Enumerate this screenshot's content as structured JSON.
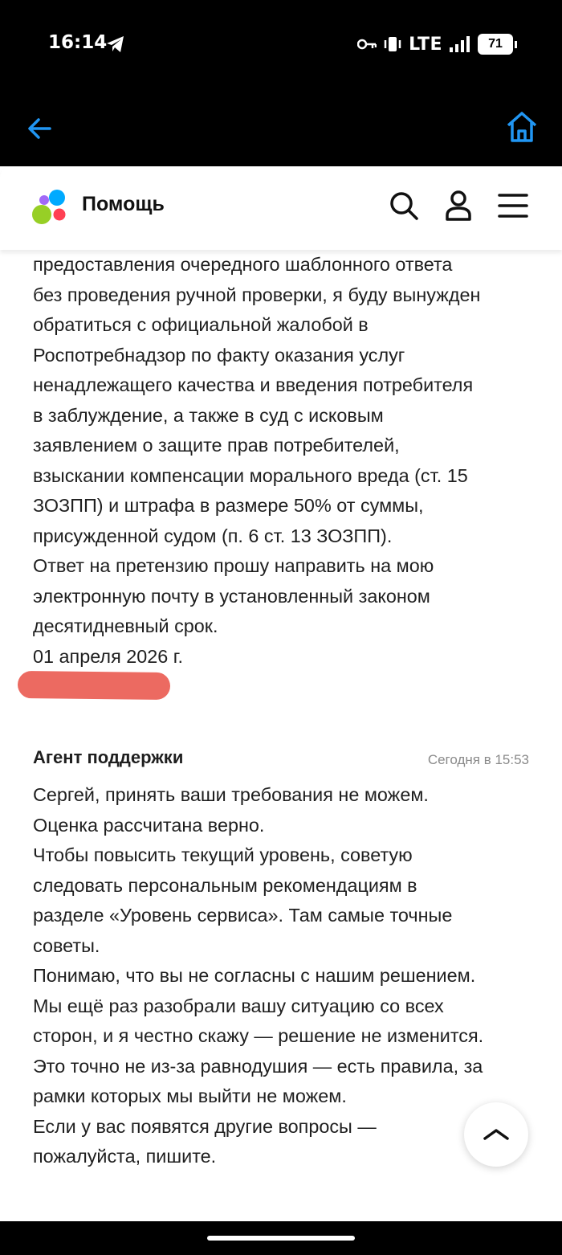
{
  "status_bar": {
    "time": "16:14",
    "network": "LTE",
    "battery": "71",
    "icons": [
      "telegram-icon",
      "key-icon",
      "vibrate-icon",
      "signal-icon",
      "battery-icon"
    ]
  },
  "browser": {
    "icons": [
      "back-arrow-icon",
      "home-icon"
    ],
    "accent": "#2196f3"
  },
  "header": {
    "title": "Помощь",
    "icons": [
      "logo-icon",
      "search-icon",
      "profile-icon",
      "menu-icon"
    ],
    "logo_colors": [
      "#00aaff",
      "#97cf26",
      "#a169f7",
      "#ff4053"
    ]
  },
  "claim": {
    "lines": [
      "предоставления очередного шаблонного ответа",
      "без проведения ручной проверки, я буду вынужден",
      "обратиться с официальной жалобой в",
      "Роспотребнадзор по факту оказания услуг",
      "ненадлежащего качества и введения потребителя",
      "в заблуждение, а также в суд с исковым",
      "заявлением о защите прав потребителей,",
      "взыскании компенсации морального вреда (ст. 15",
      "ЗОЗПП) и штрафа в размере 50% от суммы,",
      "присужденной судом (п. 6 ст. 13 ЗОЗПП).",
      "Ответ на претензию прошу направить на мою",
      "электронную почту в установленный законом",
      "десятидневный срок.",
      "01 апреля 2026 г."
    ],
    "redaction_color": "#ec6a61"
  },
  "reply": {
    "author": "Агент поддержки",
    "time": "Сегодня в 15:53",
    "lines": [
      "Сергей, принять ваши требования не можем.",
      "Оценка рассчитана верно.",
      "Чтобы повысить текущий уровень, советую",
      "следовать персональным рекомендациям в",
      "разделе «Уровень сервиса». Там самые точные",
      "советы.",
      "Понимаю, что вы не согласны с нашим решением.",
      "Мы ещё раз разобрали вашу ситуацию со всех",
      "сторон, и я честно скажу — решение не изменится.",
      "Это точно не из-за равнодушия — есть правила, за",
      "рамки которых мы выйти не можем.",
      "Если у вас появятся другие вопросы —",
      "пожалуйста, пишите."
    ]
  },
  "scroll_top": {
    "icon": "chevron-up-icon"
  }
}
